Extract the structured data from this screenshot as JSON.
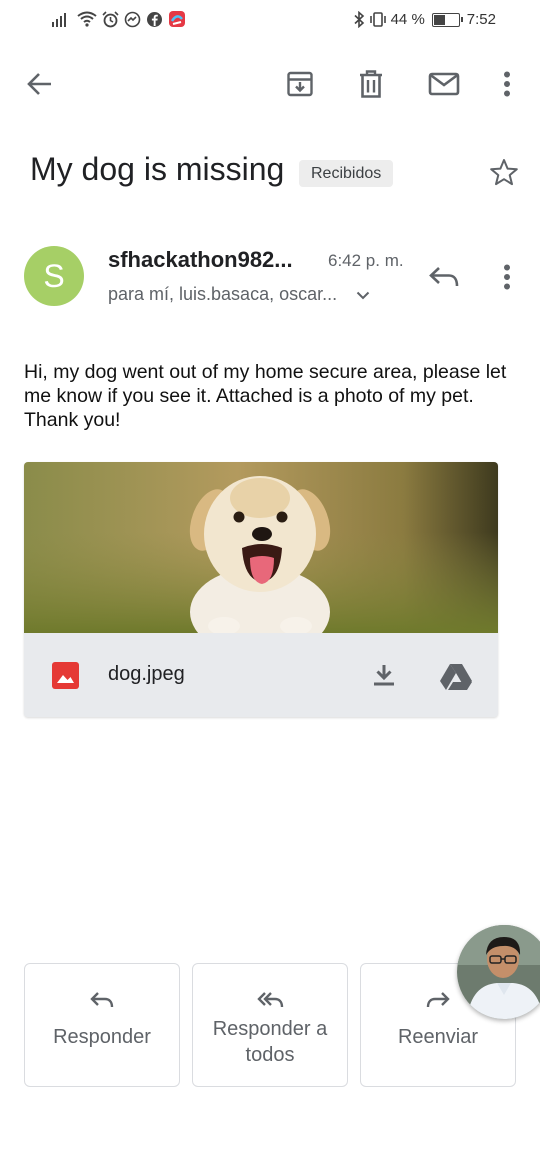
{
  "status_bar": {
    "battery_percent": "44 %",
    "time": "7:52",
    "battery_level": 0.44
  },
  "toolbar": {
    "icons": [
      "back-arrow-icon",
      "archive-icon",
      "delete-icon",
      "mark-unread-icon",
      "more-vert-icon"
    ]
  },
  "email": {
    "subject": "My dog is missing",
    "label": "Recibidos",
    "sender_initial": "S",
    "sender": "sfhackathon982...",
    "time": "6:42 p. m.",
    "recipients": "para mí, luis.basaca, oscar...",
    "body": "Hi, my dog went out of my home secure area, please let me know if you see it. Attached is a photo of my pet. Thank you!",
    "avatar_color": "#a6cf66"
  },
  "attachment": {
    "filename": "dog.jpeg",
    "file_icon_color": "#e53935"
  },
  "actions": {
    "reply": "Responder",
    "reply_all": "Responder a todos",
    "forward": "Reenviar"
  }
}
